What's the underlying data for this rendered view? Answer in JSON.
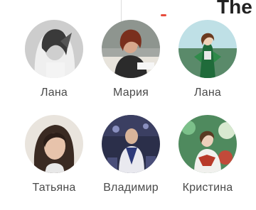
{
  "header": {
    "clipped_title": "The"
  },
  "friends": [
    {
      "name": "Лана"
    },
    {
      "name": "Мария"
    },
    {
      "name": "Лана"
    },
    {
      "name": "Татьяна"
    },
    {
      "name": "Владимир"
    },
    {
      "name": "Кристина"
    }
  ]
}
